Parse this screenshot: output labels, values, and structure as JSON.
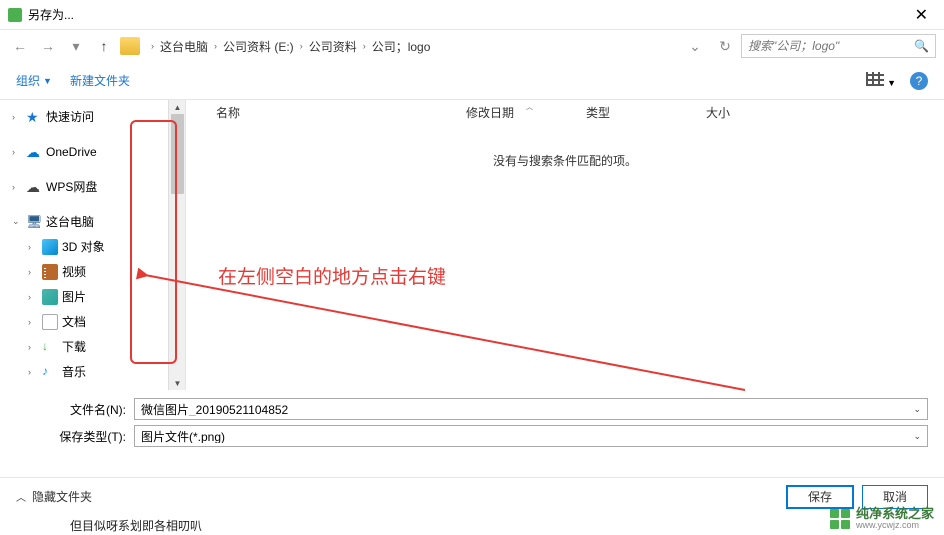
{
  "window": {
    "title": "另存为...",
    "close": "✕"
  },
  "breadcrumb": {
    "items": [
      "这台电脑",
      "公司资料 (E:)",
      "公司资料",
      "公司；logo"
    ]
  },
  "search": {
    "placeholder": "搜索\"公司；logo\"",
    "icon": "🔍"
  },
  "nav": {
    "back": "←",
    "forward": "→",
    "dropdown": "▾",
    "up": "↑",
    "refresh": "↻"
  },
  "toolbar": {
    "organize": "组织",
    "newfolder": "新建文件夹",
    "help_symbol": "?"
  },
  "columns": {
    "name": "名称",
    "date": "修改日期",
    "type": "类型",
    "size": "大小"
  },
  "content": {
    "empty": "没有与搜索条件匹配的项。"
  },
  "sidebar": {
    "items": [
      {
        "label": "快速访问",
        "icon": "star",
        "chevron": "›",
        "indent": 0
      },
      {
        "label": "OneDrive",
        "icon": "cloud-blue",
        "chevron": "›",
        "indent": 0
      },
      {
        "label": "WPS网盘",
        "icon": "cloud",
        "chevron": "›",
        "indent": 0
      },
      {
        "label": "这台电脑",
        "icon": "pc",
        "chevron": "⌄",
        "indent": 0
      },
      {
        "label": "3D 对象",
        "icon": "3d",
        "chevron": "›",
        "indent": 1
      },
      {
        "label": "视频",
        "icon": "video",
        "chevron": "›",
        "indent": 1
      },
      {
        "label": "图片",
        "icon": "pic",
        "chevron": "›",
        "indent": 1
      },
      {
        "label": "文档",
        "icon": "doc",
        "chevron": "›",
        "indent": 1
      },
      {
        "label": "下载",
        "icon": "down",
        "chevron": "›",
        "indent": 1
      },
      {
        "label": "音乐",
        "icon": "music",
        "chevron": "›",
        "indent": 1
      }
    ]
  },
  "fields": {
    "filename_label": "文件名(N):",
    "filename_value": "微信图片_20190521104852",
    "filetype_label": "保存类型(T):",
    "filetype_value": "图片文件(*.png)"
  },
  "footer": {
    "hide": "隐藏文件夹",
    "save": "保存",
    "cancel": "取消"
  },
  "annotation": {
    "text": "在左侧空白的地方点击右键"
  },
  "watermark": {
    "title": "纯净系统之家",
    "url": "www.ycwjz.com"
  },
  "cropped_text": "但目似呀系划即各相叨叭"
}
